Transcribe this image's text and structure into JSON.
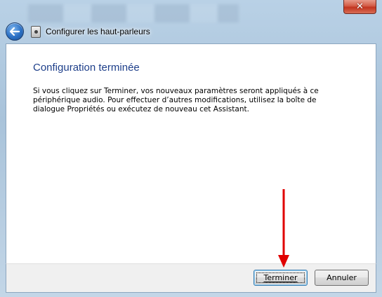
{
  "window": {
    "title": "Configurer les haut-parleurs",
    "close_label": "✕"
  },
  "content": {
    "heading": "Configuration terminée",
    "body_lines": [
      "Si vous cliquez sur Terminer, vos nouveaux paramètres seront appliqués à ce",
      "périphérique audio. Pour effectuer d’autres modifications, utilisez la boîte de",
      "dialogue Propriétés ou exécutez de nouveau cet Assistant."
    ]
  },
  "footer": {
    "finish_label": "Terminer",
    "cancel_label": "Annuler"
  },
  "colors": {
    "heading": "#1e3f8a",
    "annotation_arrow": "#e00000",
    "close_button": "#c2341f"
  },
  "icons": {
    "back": "back-arrow-icon",
    "app": "speaker-icon",
    "close": "close-icon",
    "annotation": "red-down-arrow-icon"
  }
}
